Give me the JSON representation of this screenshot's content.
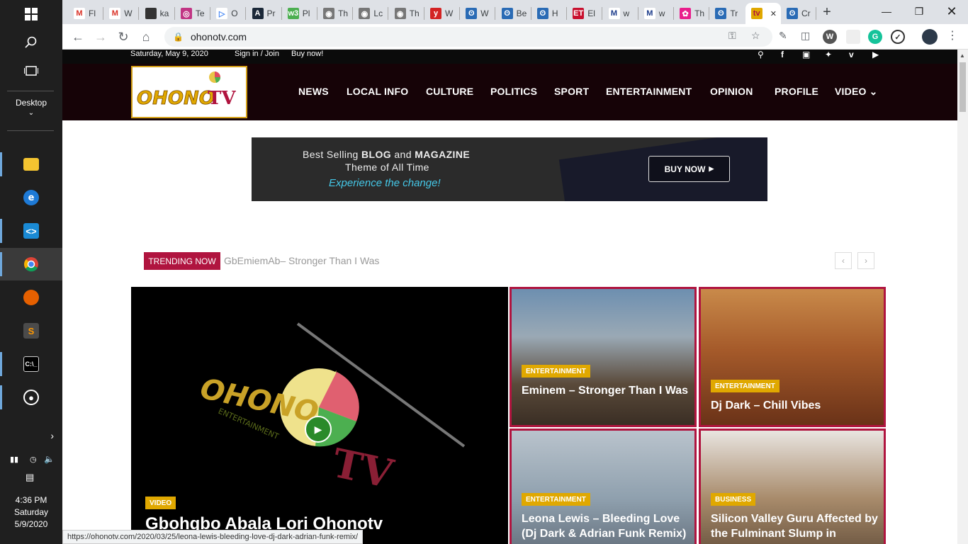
{
  "taskbar": {
    "desktop_label": "Desktop",
    "clock_time": "4:36 PM",
    "clock_day": "Saturday",
    "clock_date": "5/9/2020"
  },
  "browser": {
    "tabs": [
      {
        "label": "Fl",
        "icon": "gmail-icon"
      },
      {
        "label": "W",
        "icon": "gmail-icon"
      },
      {
        "label": "ka",
        "icon": "image-icon"
      },
      {
        "label": "Te",
        "icon": "instagram-icon"
      },
      {
        "label": "O",
        "icon": "play-icon"
      },
      {
        "label": "Pr",
        "icon": "app-icon"
      },
      {
        "label": "Pl",
        "icon": "w3-icon"
      },
      {
        "label": "Th",
        "icon": "globe-icon"
      },
      {
        "label": "Lc",
        "icon": "globe-icon"
      },
      {
        "label": "Th",
        "icon": "globe-icon"
      },
      {
        "label": "W",
        "icon": "yelp-icon"
      },
      {
        "label": "W",
        "icon": "site-icon"
      },
      {
        "label": "Be",
        "icon": "site-icon"
      },
      {
        "label": "H",
        "icon": "site-icon"
      },
      {
        "label": "El",
        "icon": "et-icon"
      },
      {
        "label": "w",
        "icon": "m-icon"
      },
      {
        "label": "w",
        "icon": "m-icon"
      },
      {
        "label": "Th",
        "icon": "star-icon"
      },
      {
        "label": "Tr",
        "icon": "site-icon"
      },
      {
        "label": "",
        "icon": "ohonotv-icon"
      },
      {
        "label": "Cr",
        "icon": "site-icon"
      }
    ],
    "url": "ohonotv.com",
    "status_url": "https://ohonotv.com/2020/03/25/leona-lewis-bleeding-love-dj-dark-adrian-funk-remix/"
  },
  "site": {
    "date": "Saturday, May 9, 2020",
    "signin": "Sign in / Join",
    "buy": "Buy now!",
    "logo_text": "OHONOTV",
    "nav": [
      "NEWS",
      "LOCAL INFO",
      "CULTURE",
      "POLITICS",
      "SPORT",
      "ENTERTAINMENT",
      "OPINION",
      "PROFILE",
      "VIDEO"
    ],
    "banner": {
      "line1_pre": "Best Selling",
      "line1_b1": "BLOG",
      "line1_mid": "and",
      "line1_b2": "MAGAZINE",
      "line2": "Theme of All Time",
      "line3": "Experience the change!",
      "button": "BUY NOW"
    },
    "trending_label": "TRENDING NOW",
    "trending_text": "GbEmiemAb– Stronger Than I Was",
    "featured": {
      "category": "VIDEO",
      "title": "Gbohgbo Abala Lori Ohonotv",
      "logo_sub": "ENTERTAINMENT"
    },
    "tiles": [
      {
        "category": "ENTERTAINMENT",
        "title": "Eminem – Stronger Than I Was"
      },
      {
        "category": "ENTERTAINMENT",
        "title": "Dj Dark – Chill Vibes"
      },
      {
        "category": "ENTERTAINMENT",
        "title": "Leona Lewis – Bleeding Love (Dj Dark & Adrian Funk Remix)"
      },
      {
        "category": "BUSINESS",
        "title": "Silicon Valley Guru Affected by the Fulminant Slump in Investment"
      }
    ]
  }
}
